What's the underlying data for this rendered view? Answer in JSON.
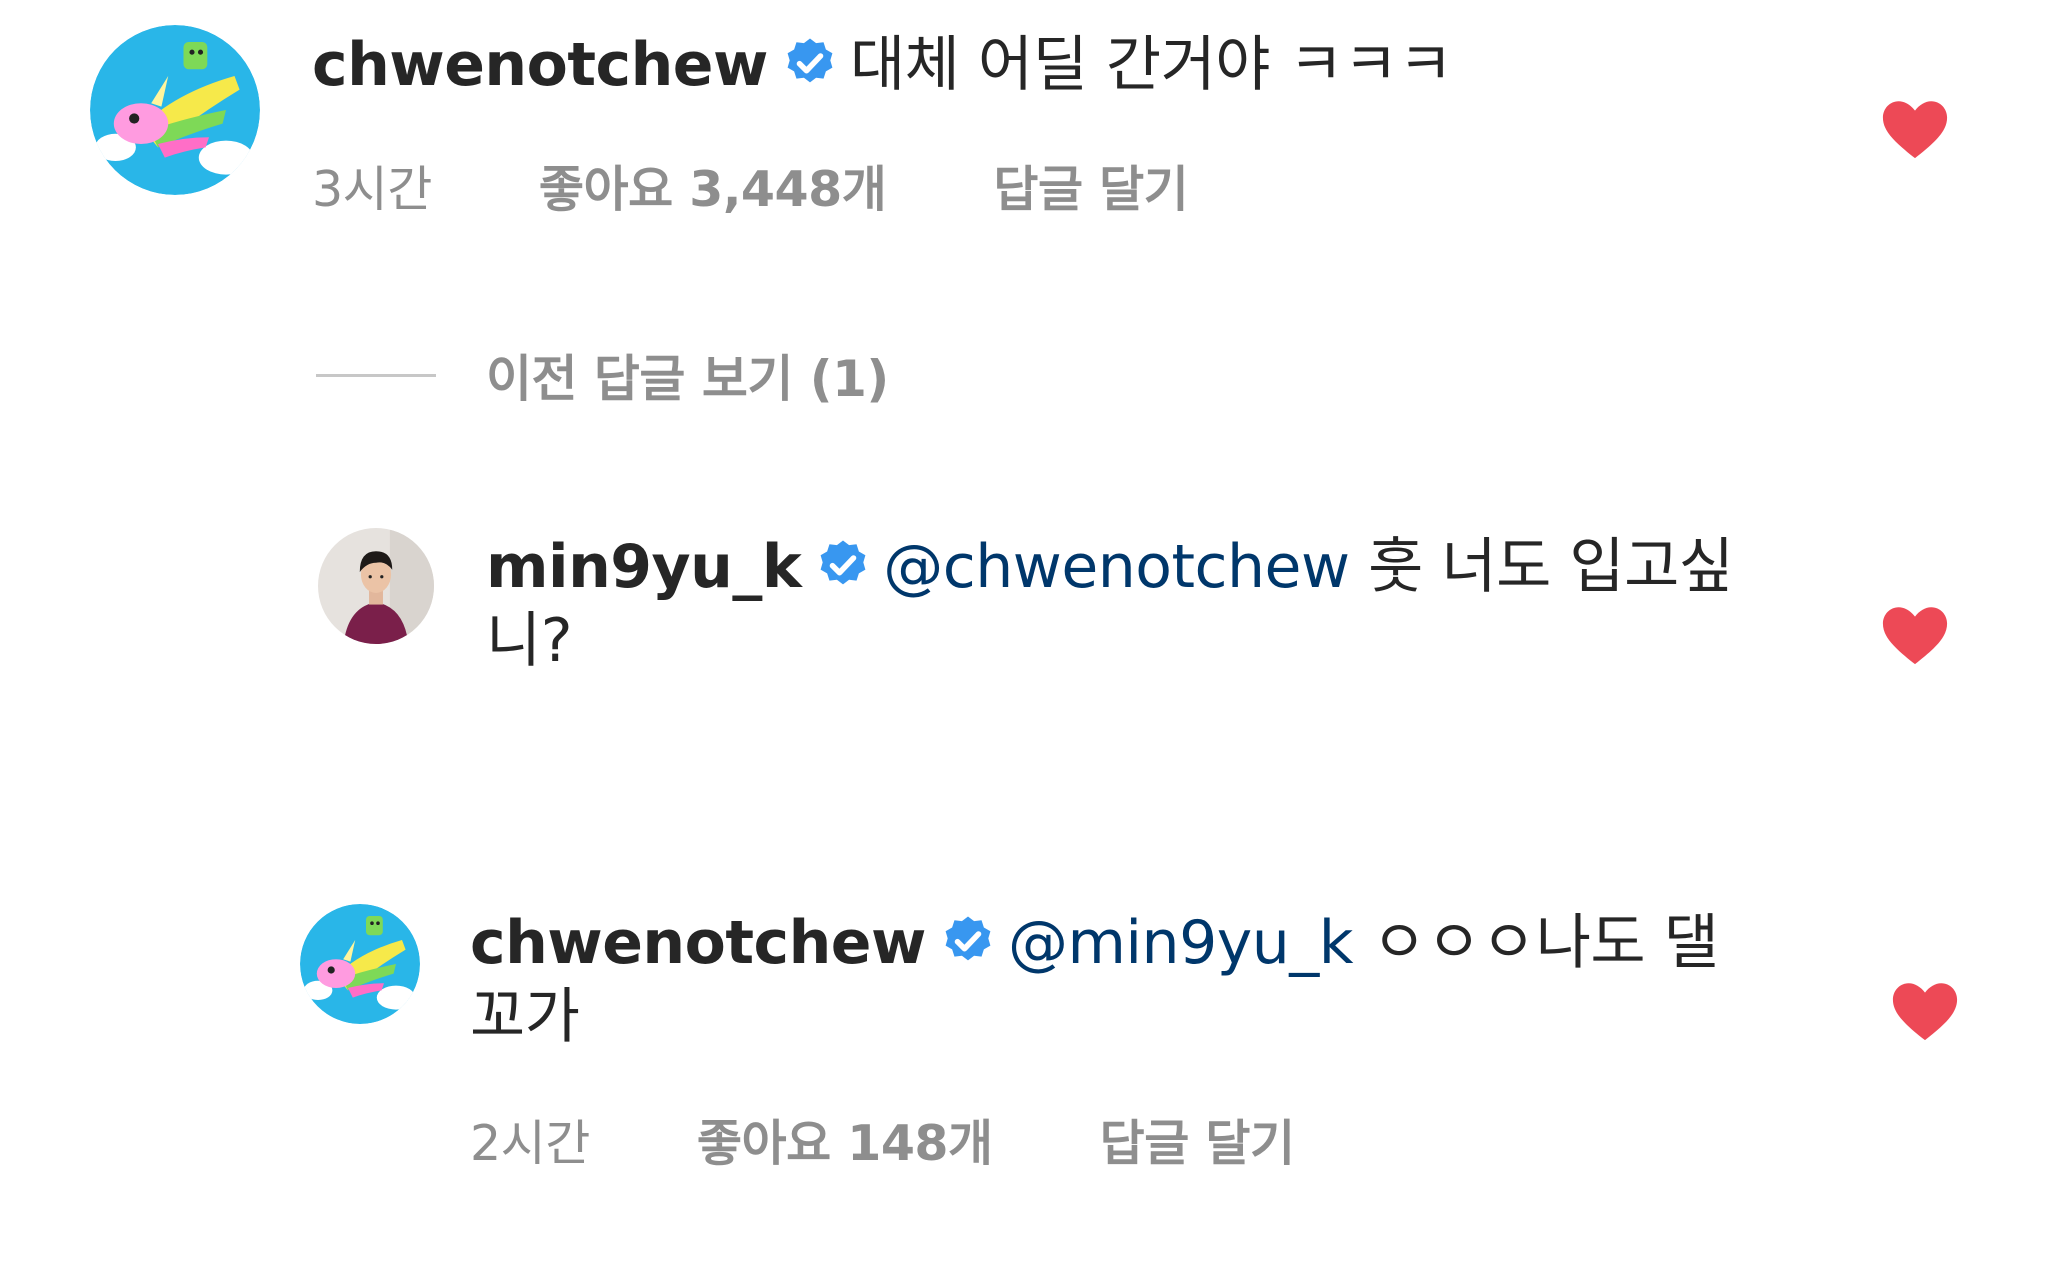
{
  "comments": [
    {
      "username": "chwenotchew",
      "verified": true,
      "mention": "",
      "text": "대체 어딜 간거야 ㅋㅋㅋ",
      "time": "3시간",
      "likes": "좋아요 3,448개",
      "reply_label": "답글 달기",
      "liked": true,
      "avatar_icon": "unicorn-cartoon-avatar"
    },
    {
      "username": "min9yu_k",
      "verified": true,
      "mention": "@chwenotchew",
      "text": "훗 너도 입고싶니?",
      "liked": true,
      "avatar_icon": "person-photo-avatar"
    },
    {
      "username": "chwenotchew",
      "verified": true,
      "mention": "@min9yu_k",
      "text": "ㅇㅇㅇ나도 댈꼬가",
      "time": "2시간",
      "likes": "좋아요 148개",
      "reply_label": "답글 달기",
      "liked": true,
      "avatar_icon": "unicorn-cartoon-avatar"
    }
  ],
  "view_previous_replies": "이전 답글 보기 (1)",
  "colors": {
    "heart": "#ed4956",
    "verified": "#3897f0",
    "mention": "#00376b",
    "meta": "#8e8e8e",
    "text": "#262626"
  }
}
